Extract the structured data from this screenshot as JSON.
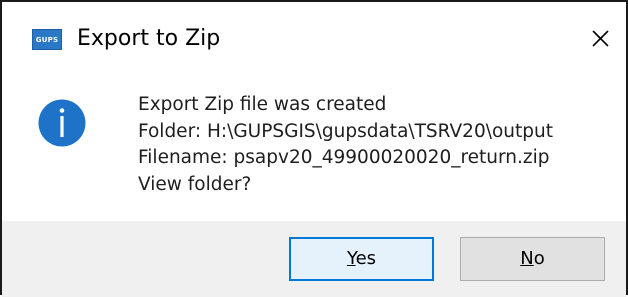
{
  "window": {
    "title": "Export to Zip",
    "app_icon_text": "GUPS"
  },
  "message": {
    "lines": [
      "Export Zip file was created",
      "Folder: H:\\GUPSGIS\\gupsdata\\TSRV20\\output",
      "Filename: psapv20_49900020020_return.zip",
      "View folder?"
    ]
  },
  "buttons": {
    "yes": {
      "mnemonic": "Y",
      "rest": "es"
    },
    "no": {
      "mnemonic": "N",
      "rest": "o"
    }
  },
  "colors": {
    "info_icon": "#1e73c8",
    "default_button_border": "#0078d7",
    "footer_background": "#f0f0f0"
  },
  "icons": {
    "app": "gups-app-icon",
    "close": "close-icon",
    "message": "information-icon"
  }
}
